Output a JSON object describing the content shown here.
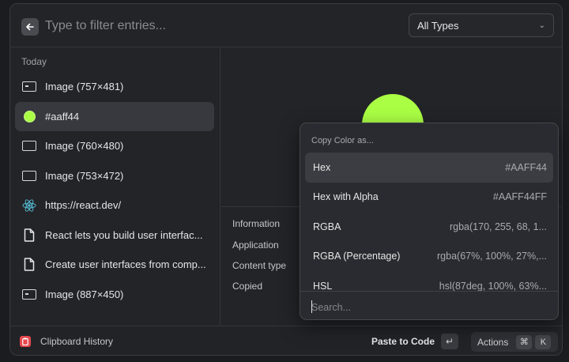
{
  "header": {
    "filter_placeholder": "Type to filter entries...",
    "type_filter": "All Types"
  },
  "sidebar": {
    "section": "Today",
    "items": [
      {
        "label": "Image (757×481)",
        "icon": "image-icon"
      },
      {
        "label": "#aaff44",
        "icon": "color-swatch-icon"
      },
      {
        "label": "Image (760×480)",
        "icon": "image-icon"
      },
      {
        "label": "Image (753×472)",
        "icon": "image-icon"
      },
      {
        "label": "https://react.dev/",
        "icon": "react-icon"
      },
      {
        "label": "React lets you build user interfac...",
        "icon": "file-icon"
      },
      {
        "label": "Create user interfaces from comp...",
        "icon": "file-icon"
      },
      {
        "label": "Image (887×450)",
        "icon": "image-icon"
      }
    ]
  },
  "preview": {
    "color": "#aaff44"
  },
  "info": {
    "heading": "Information",
    "rows": [
      "Application",
      "Content type",
      "Copied"
    ]
  },
  "popover": {
    "title": "Copy Color as...",
    "items": [
      {
        "label": "Hex",
        "value": "#AAFF44"
      },
      {
        "label": "Hex with Alpha",
        "value": "#AAFF44FF"
      },
      {
        "label": "RGBA",
        "value": "rgba(170, 255, 68, 1..."
      },
      {
        "label": "RGBA (Percentage)",
        "value": "rgba(67%, 100%, 27%,..."
      },
      {
        "label": "HSL",
        "value": "hsl(87deg, 100%, 63%..."
      }
    ],
    "search_placeholder": "Search..."
  },
  "footer": {
    "app_title": "Clipboard History",
    "primary_action": "Paste to Code",
    "enter_key": "↵",
    "actions_label": "Actions",
    "shortcut_mod": "⌘",
    "shortcut_key": "K"
  },
  "colors": {
    "accent": "#aaff44",
    "app_icon": "#e5484d",
    "react": "#58c4dc"
  }
}
